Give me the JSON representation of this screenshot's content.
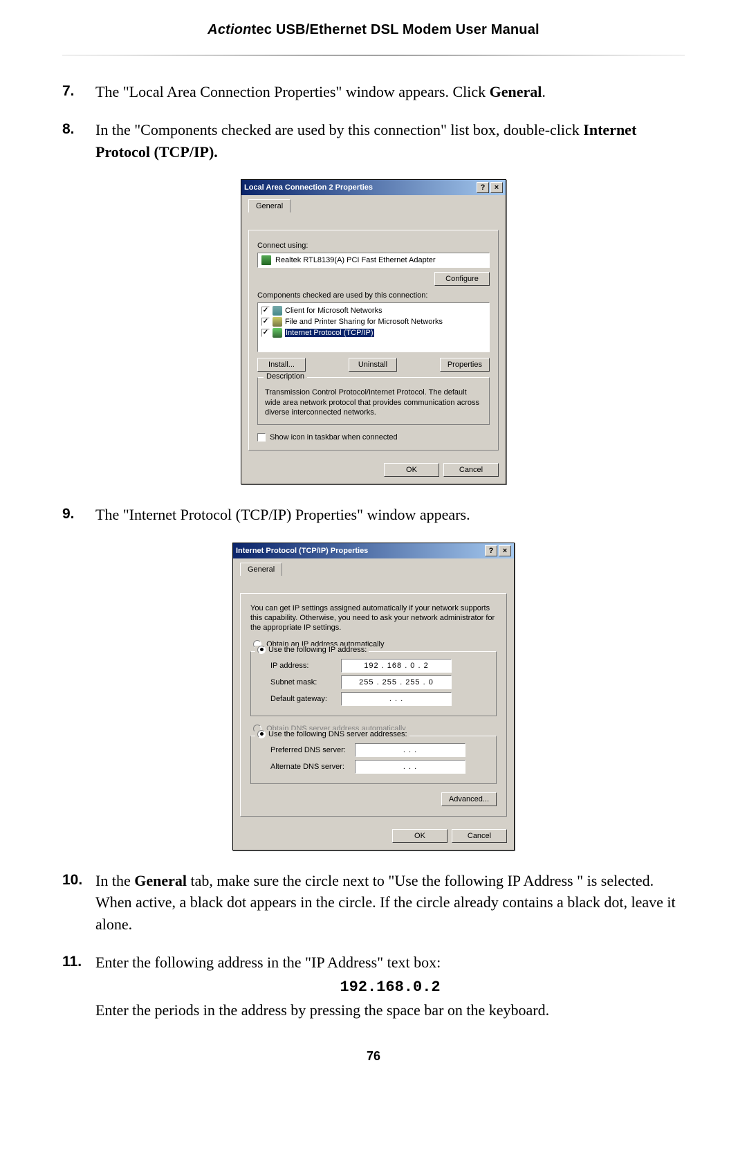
{
  "header": {
    "brand_prefix": "Action",
    "brand_suffix": "tec",
    "title_rest": " USB/Ethernet DSL Modem User Manual"
  },
  "steps": {
    "s7": {
      "num": "7.",
      "text_a": "The \"Local Area Connection Properties\" window appears. Click ",
      "bold_a": "General",
      "text_b": "."
    },
    "s8": {
      "num": "8.",
      "text_a": "In the \"Components checked are used by this connection\" list box, double-click ",
      "bold_a": "Internet Protocol (",
      "sc_a": "TCP/IP",
      "text_b": ")."
    },
    "s9": {
      "num": "9.",
      "text_a": "The \"Internet Protocol (",
      "sc_a": "TCP/IP",
      "text_b": ") Properties\" window appears."
    },
    "s10": {
      "num": "10.",
      "text_a": "In the ",
      "bold_a": "General",
      "text_b": " tab, make sure the circle next to \"Use the following ",
      "sc_a": "IP",
      "text_c": " Address \" is selected. When active, a black dot appears in the circle. If the circle already contains a black dot, leave it alone."
    },
    "s11": {
      "num": "11.",
      "text_a": "Enter the following address in the \"",
      "sc_a": "IP",
      "text_b": " Address\" text box:",
      "ip_value": "192.168.0.2",
      "text_c": "Enter the periods in the address by pressing the space bar on the keyboard."
    }
  },
  "dialog1": {
    "title": "Local Area Connection 2 Properties",
    "help": "?",
    "close": "×",
    "tab_general": "General",
    "connect_using_label": "Connect using:",
    "adapter": "Realtek RTL8139(A) PCI Fast Ethernet Adapter",
    "configure_btn": "Configure",
    "components_label": "Components checked are used by this connection:",
    "items": [
      {
        "label": "Client for Microsoft Networks"
      },
      {
        "label": "File and Printer Sharing for Microsoft Networks"
      },
      {
        "label": "Internet Protocol (TCP/IP)"
      }
    ],
    "install_btn": "Install...",
    "uninstall_btn": "Uninstall",
    "properties_btn": "Properties",
    "desc_title": "Description",
    "desc_text": "Transmission Control Protocol/Internet Protocol. The default wide area network protocol that provides communication across diverse interconnected networks.",
    "show_icon_label": "Show icon in taskbar when connected",
    "ok_btn": "OK",
    "cancel_btn": "Cancel"
  },
  "dialog2": {
    "title": "Internet Protocol (TCP/IP) Properties",
    "help": "?",
    "close": "×",
    "tab_general": "General",
    "intro": "You can get IP settings assigned automatically if your network supports this capability. Otherwise, you need to ask your network administrator for the appropriate IP settings.",
    "radio_obtain_ip": "Obtain an IP address automatically",
    "radio_use_ip": "Use the following IP address:",
    "ip_label": "IP address:",
    "ip_value": "192 . 168 .  0  .  2",
    "subnet_label": "Subnet mask:",
    "subnet_value": "255 . 255 . 255 .  0",
    "gateway_label": "Default gateway:",
    "gateway_value": " .       .       . ",
    "radio_obtain_dns": "Obtain DNS server address automatically",
    "radio_use_dns": "Use the following DNS server addresses:",
    "pref_dns_label": "Preferred DNS server:",
    "pref_dns_value": " .       .       . ",
    "alt_dns_label": "Alternate DNS server:",
    "alt_dns_value": " .       .       . ",
    "advanced_btn": "Advanced...",
    "ok_btn": "OK",
    "cancel_btn": "Cancel"
  },
  "page_number": "76"
}
